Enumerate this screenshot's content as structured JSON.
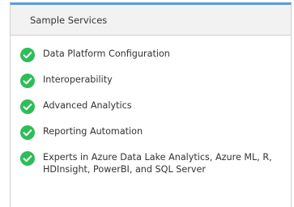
{
  "panel": {
    "title": "Sample Services",
    "accent_color": "#5b9bd5",
    "check_color": "#2ebd59",
    "check_icon": "check-circle-icon",
    "items": [
      {
        "label": "Data Platform Configuration"
      },
      {
        "label": "Interoperability"
      },
      {
        "label": "Advanced Analytics"
      },
      {
        "label": "Reporting Automation"
      },
      {
        "label": "Experts in Azure Data Lake Analytics, Azure ML, R, HDInsight, PowerBI, and SQL Server"
      }
    ]
  }
}
